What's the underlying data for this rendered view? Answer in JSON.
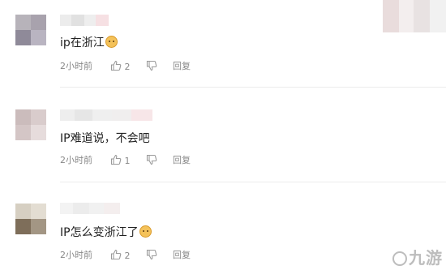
{
  "comments": [
    {
      "text": "ip在浙江",
      "emoji": "dog-face-emoji",
      "time": "2小时前",
      "likes": "2",
      "reply_label": "回复"
    },
    {
      "text": "IP难道说，不会吧",
      "emoji": "",
      "time": "2小时前",
      "likes": "1",
      "reply_label": "回复"
    },
    {
      "text": "IP怎么变浙江了",
      "emoji": "dog-face-emoji",
      "time": "2小时前",
      "likes": "2",
      "reply_label": "回复"
    }
  ],
  "icons": {
    "like": "thumbs-up-icon",
    "dislike": "thumbs-down-icon",
    "watermark_logo": "jiuyou-logo-icon"
  },
  "colors": {
    "meta_text": "#888888",
    "body_text": "#222222",
    "divider": "#ececec"
  },
  "watermark": {
    "text": "九游"
  }
}
